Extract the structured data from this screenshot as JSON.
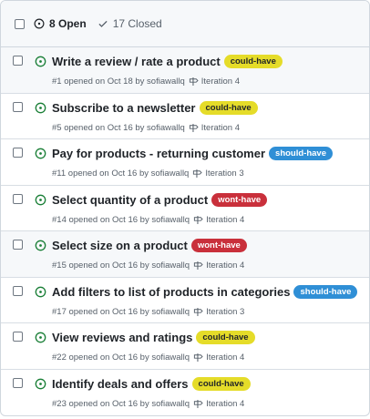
{
  "header": {
    "open_label": "8 Open",
    "closed_label": "17 Closed"
  },
  "colors": {
    "open_icon": "#1a7f37",
    "could_have": "#e5dc29",
    "should_have": "#2f8fd6",
    "wont_have": "#c9303b"
  },
  "issues": [
    {
      "title": "Write a review / rate a product",
      "label": "could-have",
      "label_type": "could",
      "meta": "#1 opened on Oct 18 by sofiawallq",
      "milestone": "Iteration 4"
    },
    {
      "title": "Subscribe to a newsletter",
      "label": "could-have",
      "label_type": "could",
      "meta": "#5 opened on Oct 16 by sofiawallq",
      "milestone": "Iteration 4"
    },
    {
      "title": "Pay for products - returning customer",
      "label": "should-have",
      "label_type": "should",
      "meta": "#11 opened on Oct 16 by sofiawallq",
      "milestone": "Iteration 3"
    },
    {
      "title": "Select quantity of a product",
      "label": "wont-have",
      "label_type": "wont",
      "meta": "#14 opened on Oct 16 by sofiawallq",
      "milestone": "Iteration 4"
    },
    {
      "title": "Select size on a product",
      "label": "wont-have",
      "label_type": "wont",
      "meta": "#15 opened on Oct 16 by sofiawallq",
      "milestone": "Iteration 4"
    },
    {
      "title": "Add filters to list of products in categories",
      "label": "should-have",
      "label_type": "should",
      "meta": "#17 opened on Oct 16 by sofiawallq",
      "milestone": "Iteration 3"
    },
    {
      "title": "View reviews and ratings",
      "label": "could-have",
      "label_type": "could",
      "meta": "#22 opened on Oct 16 by sofiawallq",
      "milestone": "Iteration 4"
    },
    {
      "title": "Identify deals and offers",
      "label": "could-have",
      "label_type": "could",
      "meta": "#23 opened on Oct 16 by sofiawallq",
      "milestone": "Iteration 4"
    }
  ]
}
